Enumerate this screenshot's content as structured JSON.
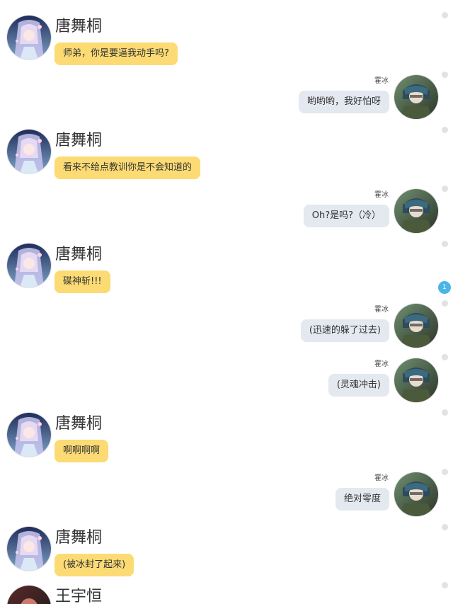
{
  "characters": {
    "tang": {
      "name": "唐舞桐"
    },
    "huo": {
      "name": "霍冰"
    },
    "wang": {
      "name": "王宇恒"
    }
  },
  "messages": [
    {
      "speaker": "唐舞桐",
      "side": "left",
      "text": "师弟，你是要逼我动手吗?"
    },
    {
      "speaker": "霍冰",
      "side": "right",
      "text": "哟哟哟，我好怕呀"
    },
    {
      "speaker": "唐舞桐",
      "side": "left",
      "text": "看来不给点教训你是不会知道的"
    },
    {
      "speaker": "霍冰",
      "side": "right",
      "text": "Oh?是吗?（冷）"
    },
    {
      "speaker": "唐舞桐",
      "side": "left",
      "text": "碟神斩!!!"
    },
    {
      "speaker": "霍冰",
      "side": "right",
      "text": "(迅速的躲了过去)"
    },
    {
      "speaker": "霍冰",
      "side": "right",
      "text": "(灵魂冲击)"
    },
    {
      "speaker": "唐舞桐",
      "side": "left",
      "text": "啊啊啊啊"
    },
    {
      "speaker": "霍冰",
      "side": "right",
      "text": "绝对零度"
    },
    {
      "speaker": "唐舞桐",
      "side": "left",
      "text": "(被冰封了起来)"
    },
    {
      "speaker": "王宇恒",
      "side": "left",
      "text": ""
    }
  ],
  "unread_badge": "1",
  "colors": {
    "left_bubble": "#fcdb74",
    "right_bubble": "#e4e8ef",
    "badge": "#4ab5e6"
  }
}
